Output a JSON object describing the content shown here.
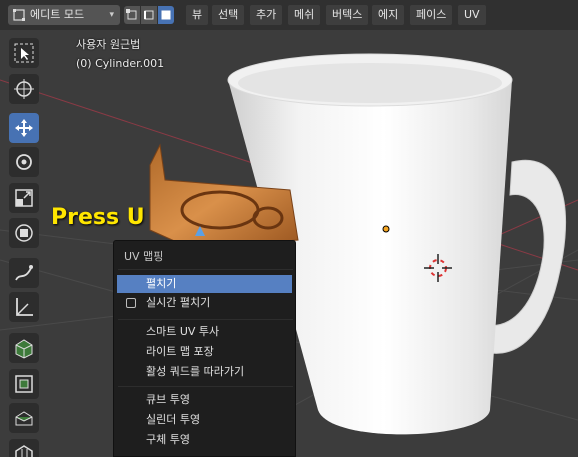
{
  "header": {
    "mode_label": "에디트 모드",
    "menus": [
      "뷰",
      "선택",
      "추가",
      "메쉬",
      "버텍스",
      "에지",
      "페이스",
      "UV"
    ]
  },
  "toolbar": {
    "tools": [
      {
        "name": "select-box-icon",
        "active": false
      },
      {
        "name": "cursor-icon",
        "active": false
      },
      {
        "name": "move-icon",
        "active": true
      },
      {
        "name": "rotate-icon",
        "active": false
      },
      {
        "name": "scale-icon",
        "active": false
      },
      {
        "name": "transform-icon",
        "active": false
      },
      {
        "name": "annotate-icon",
        "active": false
      },
      {
        "name": "measure-icon",
        "active": false
      },
      {
        "name": "add-cube-icon",
        "active": false
      },
      {
        "name": "extrude-icon",
        "active": false
      },
      {
        "name": "inset-icon",
        "active": false
      },
      {
        "name": "bevel-icon",
        "active": false
      }
    ]
  },
  "viewport": {
    "view_name": "사용자 원근법",
    "object_name": "(0) Cylinder.001",
    "annotation": "Press U"
  },
  "uv_menu": {
    "title": "UV 맵핑",
    "items": [
      {
        "label": "펼치기",
        "highlighted": true
      },
      {
        "label": "실시간 펼치기",
        "checkbox": true
      },
      {
        "label": "스마트 UV 투사"
      },
      {
        "label": "라이트 맵 포장"
      },
      {
        "label": "활성 쿼드를 따라가기"
      },
      {
        "label": "큐브 투영"
      },
      {
        "label": "실린더 투영"
      },
      {
        "label": "구체 투영"
      }
    ]
  },
  "colors": {
    "accent": "#4772b3",
    "highlight": "#5680c2",
    "annotation": "#ffe600"
  }
}
